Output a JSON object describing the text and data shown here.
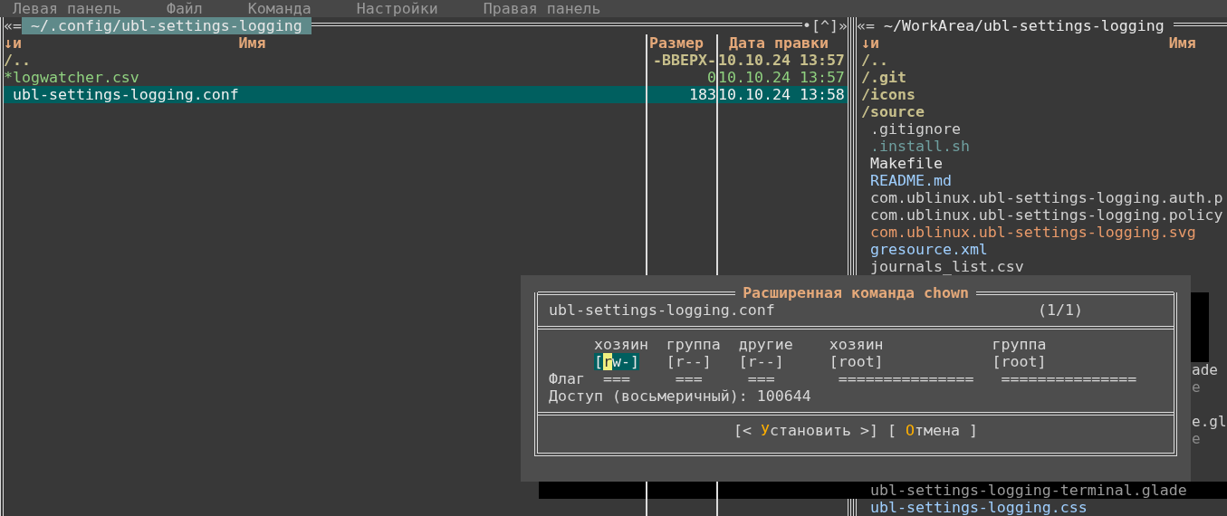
{
  "menu": [
    "Левая панель",
    "Файл",
    "Команда",
    "Настройки",
    "Правая панель"
  ],
  "left_panel": {
    "corner": "«=",
    "path": "~/.config/ubl-settings-logging",
    "active": true,
    "marks": "•[^]»",
    "columns": {
      "sort": "↓и",
      "name": "Имя",
      "size": "Размер",
      "date": "Дата правки"
    },
    "rows": [
      {
        "name": "/..",
        "size": "-ВВЕРХ-",
        "date": "10.10.24 13:57",
        "kind": "dir",
        "selected": false
      },
      {
        "name": "*logwatcher.csv",
        "size": "0",
        "date": "10.10.24 13:57",
        "kind": "executable",
        "selected": false
      },
      {
        "name": "ubl-settings-logging.conf",
        "size": "183",
        "date": "10.10.24 13:58",
        "kind": "file",
        "selected": true
      }
    ]
  },
  "right_panel": {
    "corner": "«=",
    "path": "~/WorkArea/ubl-settings-logging",
    "active": false,
    "columns": {
      "sort": "↓и",
      "name": "Имя"
    },
    "rows": [
      {
        "kind": "dir",
        "name": "/..",
        "color": "#c8c08c"
      },
      {
        "kind": "dir",
        "name": "/.git",
        "color": "#c8c08c"
      },
      {
        "kind": "dir",
        "name": "/icons",
        "color": "#c8c08c"
      },
      {
        "kind": "dir",
        "name": "/source",
        "color": "#c8c08c"
      },
      {
        "kind": "file",
        "name": ".gitignore",
        "color": "#d0d0d0"
      },
      {
        "kind": "file",
        "name": ".install.sh",
        "color": "#6f9f9f"
      },
      {
        "kind": "file",
        "name": "Makefile",
        "color": "#e6e6e6"
      },
      {
        "kind": "file",
        "name": "README.md",
        "color": "#9fcfff"
      },
      {
        "kind": "file",
        "name": "com.ublinux.ubl-settings-logging.auth.p",
        "color": "#d0d0d0"
      },
      {
        "kind": "file",
        "name": "com.ublinux.ubl-settings-logging.policy",
        "color": "#d0d0d0"
      },
      {
        "kind": "file",
        "name": "com.ublinux.ubl-settings-logging.svg",
        "color": "#e99a6a"
      },
      {
        "kind": "file",
        "name": "gresource.xml",
        "color": "#9fcfff"
      },
      {
        "kind": "file",
        "name": "journals_list.csv",
        "color": "#d0d0d0"
      },
      {
        "kind": "covered"
      },
      {
        "kind": "covered"
      },
      {
        "kind": "covered"
      },
      {
        "kind": "covered"
      },
      {
        "kind": "covered"
      },
      {
        "kind": "fragment",
        "name": "ade",
        "color": "#d0d0d0"
      },
      {
        "kind": "fragment",
        "name": "e",
        "color": "#8a8a8a"
      },
      {
        "kind": "covered"
      },
      {
        "kind": "fragment",
        "name": "e.gl",
        "color": "#d0d0d0"
      },
      {
        "kind": "fragment",
        "name": "e",
        "color": "#8a8a8a"
      },
      {
        "kind": "covered"
      },
      {
        "kind": "covered"
      },
      {
        "kind": "shadowed",
        "name": "ubl-settings-logging-terminal.glade"
      },
      {
        "kind": "file",
        "name": "ubl-settings-logging.css",
        "color": "#9fcfff"
      }
    ]
  },
  "dialog": {
    "title": "Расширенная команда chown",
    "file": "ubl-settings-logging.conf",
    "counter": "(1/1)",
    "flag_label": "Флаг",
    "perms": [
      {
        "label": "хозяин",
        "value": "[rw-]",
        "flag": "===",
        "selected": true
      },
      {
        "label": "группа",
        "value": "[r--]",
        "flag": "===",
        "selected": false
      },
      {
        "label": "другие",
        "value": "[r--]",
        "flag": "===",
        "selected": false
      }
    ],
    "owners": [
      {
        "label": "хозяин",
        "value": "[root]",
        "flag": "==============="
      },
      {
        "label": "группа",
        "value": "[root]",
        "flag": "==============="
      }
    ],
    "access": "Доступ (восьмеричный): 100644",
    "buttons": [
      {
        "before": "[< ",
        "hotkey": "У",
        "after": "становить >]"
      },
      {
        "before": "[ ",
        "hotkey": "О",
        "after": "тмена ]"
      }
    ]
  }
}
